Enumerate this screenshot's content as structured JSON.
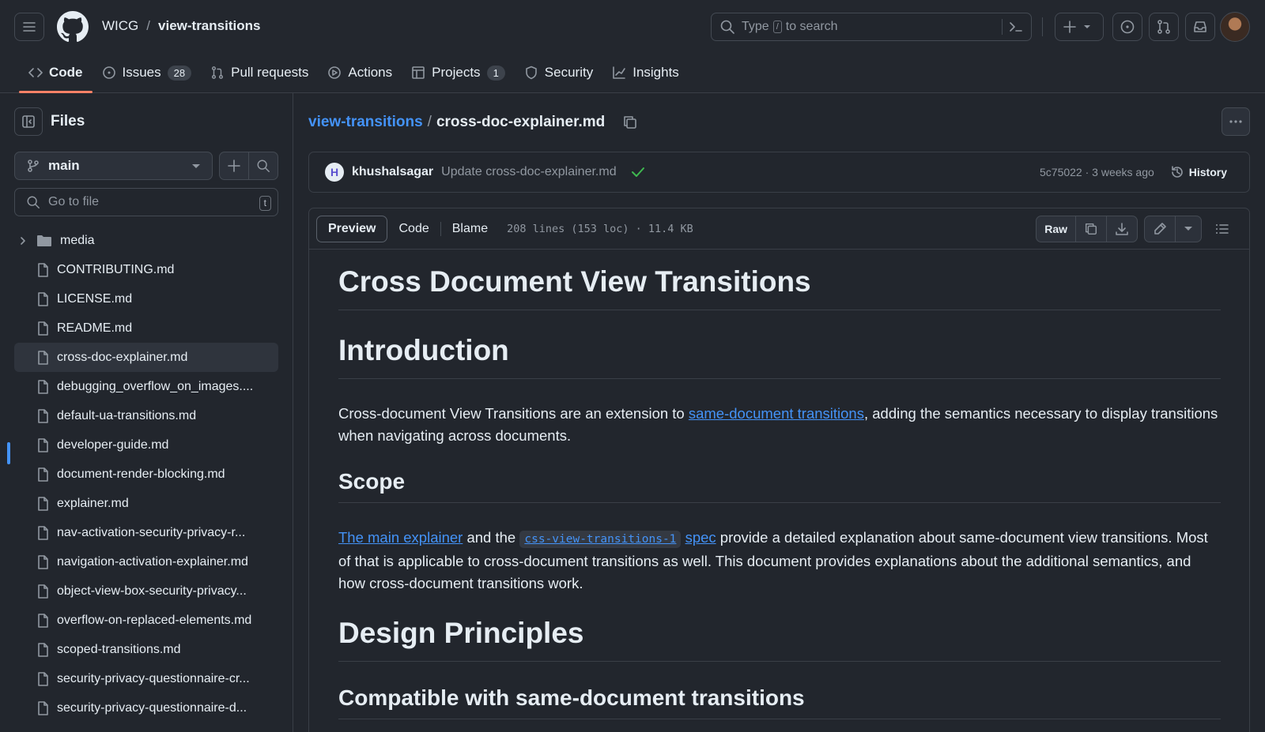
{
  "header": {
    "owner": "WICG",
    "separator": "/",
    "repo": "view-transitions",
    "search": {
      "prefix": "Type",
      "key": "/",
      "suffix": "to search"
    }
  },
  "tabs": [
    {
      "label": "Code",
      "icon": "code-icon",
      "active": true
    },
    {
      "label": "Issues",
      "icon": "issue-icon",
      "count": "28"
    },
    {
      "label": "Pull requests",
      "icon": "pull-request-icon"
    },
    {
      "label": "Actions",
      "icon": "play-icon"
    },
    {
      "label": "Projects",
      "icon": "table-icon",
      "count": "1"
    },
    {
      "label": "Security",
      "icon": "shield-icon"
    },
    {
      "label": "Insights",
      "icon": "graph-icon"
    }
  ],
  "sidebar": {
    "title": "Files",
    "branch": "main",
    "goto_placeholder": "Go to file",
    "goto_key": "t",
    "items": [
      {
        "name": "media",
        "type": "folder"
      },
      {
        "name": "CONTRIBUTING.md",
        "type": "file"
      },
      {
        "name": "LICENSE.md",
        "type": "file"
      },
      {
        "name": "README.md",
        "type": "file"
      },
      {
        "name": "cross-doc-explainer.md",
        "type": "file",
        "selected": true
      },
      {
        "name": "debugging_overflow_on_images....",
        "type": "file"
      },
      {
        "name": "default-ua-transitions.md",
        "type": "file"
      },
      {
        "name": "developer-guide.md",
        "type": "file"
      },
      {
        "name": "document-render-blocking.md",
        "type": "file"
      },
      {
        "name": "explainer.md",
        "type": "file"
      },
      {
        "name": "nav-activation-security-privacy-r...",
        "type": "file"
      },
      {
        "name": "navigation-activation-explainer.md",
        "type": "file"
      },
      {
        "name": "object-view-box-security-privacy...",
        "type": "file"
      },
      {
        "name": "overflow-on-replaced-elements.md",
        "type": "file"
      },
      {
        "name": "scoped-transitions.md",
        "type": "file"
      },
      {
        "name": "security-privacy-questionnaire-cr...",
        "type": "file"
      },
      {
        "name": "security-privacy-questionnaire-d...",
        "type": "file"
      }
    ]
  },
  "breadcrumb": {
    "repo": "view-transitions",
    "sep": "/",
    "file": "cross-doc-explainer.md"
  },
  "commit": {
    "avatar_letter": "H",
    "author": "khushalsagar",
    "message": "Update cross-doc-explainer.md",
    "hash_time": "5c75022 · 3 weeks ago",
    "history": "History"
  },
  "file_toolbar": {
    "preview": "Preview",
    "code": "Code",
    "blame": "Blame",
    "meta": "208 lines (153 loc) · 11.4 KB",
    "raw": "Raw"
  },
  "markdown": {
    "h1_title": "Cross Document View Transitions",
    "h1_intro": "Introduction",
    "intro_p_before": "Cross-document View Transitions are an extension to ",
    "intro_p_link": "same-document transitions",
    "intro_p_after": ", adding the semantics necessary to display transitions when navigating across documents.",
    "h2_scope": "Scope",
    "scope_link1": "The main explainer",
    "scope_and_the": " and the ",
    "scope_code": "css-view-transitions-1",
    "scope_spec": "spec",
    "scope_rest": " provide a detailed explanation about same-document view transitions. Most of that is applicable to cross-document transitions as well. This document provides explanations about the additional semantics, and how cross-document transitions work.",
    "h1_design": "Design Principles",
    "h2_compat": "Compatible with same-document transitions"
  },
  "colors": {
    "accent": "#4493f8",
    "active_tab": "#f78166",
    "bg": "#22262d",
    "success": "#3fb950"
  }
}
